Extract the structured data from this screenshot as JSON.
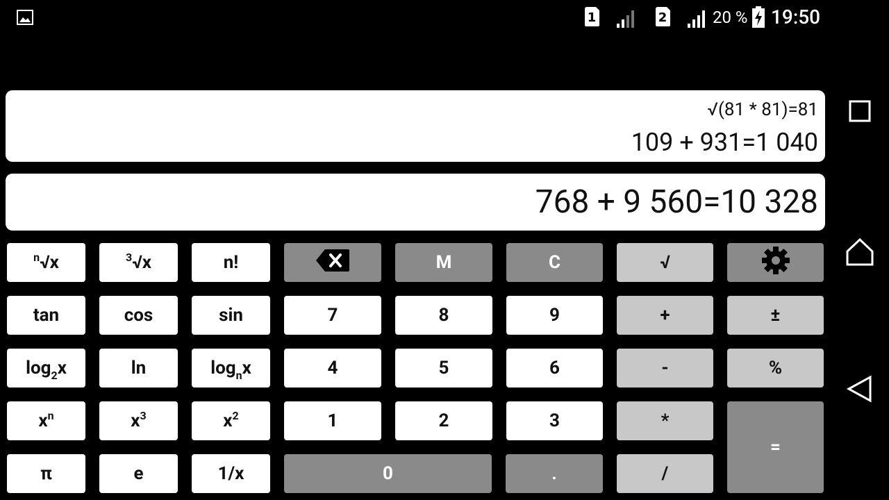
{
  "status_bar": {
    "sim1_label": "1",
    "sim2_label": "2",
    "battery_percent": "20 %",
    "time": "19:50",
    "icons": [
      "image-notification-icon",
      "sim1-icon",
      "signal1-icon",
      "sim2-icon",
      "signal2-icon",
      "battery-charging-icon"
    ]
  },
  "display": {
    "history": [
      "√(81 * 81)=81",
      "109 + 931=1 040"
    ],
    "current": "768 + 9 560=10 328"
  },
  "keys": {
    "nroot": {
      "main": "√x",
      "sup": "n"
    },
    "cuberoot": {
      "main": "√x",
      "sup": "3"
    },
    "factorial": "n!",
    "backspace_icon": "backspace-icon",
    "memory": "M",
    "clear": "C",
    "sqrt": "√",
    "settings_icon": "gear-icon",
    "tan": "tan",
    "cos": "cos",
    "sin": "sin",
    "d7": "7",
    "d8": "8",
    "d9": "9",
    "plus": "+",
    "plusminus": "±",
    "log2": {
      "main": "log",
      "sub": "2",
      "suffix": "x"
    },
    "ln": "ln",
    "logn": {
      "main": "log",
      "sub": "n",
      "suffix": "x"
    },
    "d4": "4",
    "d5": "5",
    "d6": "6",
    "minus": "-",
    "percent": "%",
    "xn": {
      "main": "x",
      "sup": "n"
    },
    "x3": {
      "main": "x",
      "sup": "3"
    },
    "x2": {
      "main": "x",
      "sup": "2"
    },
    "d1": "1",
    "d2": "2",
    "d3": "3",
    "multiply": "*",
    "equals": "=",
    "pi": "π",
    "e": "e",
    "reciprocal": "1/x",
    "d0": "0",
    "dot": ".",
    "divide": "/"
  },
  "nav_bar": {
    "icons": [
      "recents-icon",
      "home-icon",
      "back-icon"
    ]
  },
  "colors": {
    "background": "#000000",
    "panel": "#ffffff",
    "key_white": "#ffffff",
    "key_light": "#c8c8c8",
    "key_dark": "#8a8a8a"
  }
}
